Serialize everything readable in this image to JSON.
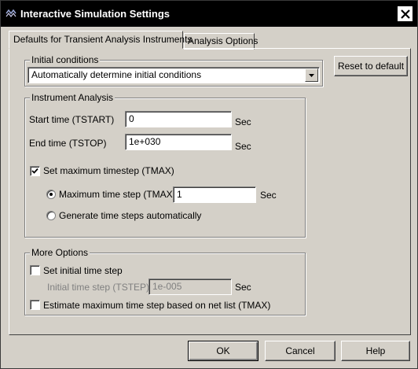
{
  "window": {
    "title": "Interactive Simulation Settings",
    "close_label": "close"
  },
  "tabs": [
    {
      "label": "Defaults for Transient Analysis Instruments",
      "active": true
    },
    {
      "label": "Analysis Options",
      "active": false
    }
  ],
  "reset_button": {
    "label": "Reset to default"
  },
  "initial_conditions": {
    "legend": "Initial conditions",
    "selected_value": "Automatically determine initial conditions"
  },
  "instrument_analysis": {
    "legend": "Instrument Analysis",
    "start_time": {
      "label": "Start time (TSTART)",
      "value": "0",
      "unit": "Sec"
    },
    "end_time": {
      "label": "End time (TSTOP)",
      "value": "1e+030",
      "unit": "Sec"
    },
    "set_max_timestep": {
      "label": "Set maximum timestep (TMAX)",
      "checked": true
    },
    "max_time_step": {
      "label": "Maximum time step (TMAX)",
      "value": "1",
      "unit": "Sec",
      "selected": true
    },
    "generate_auto": {
      "label": "Generate time steps automatically",
      "selected": false
    }
  },
  "more_options": {
    "legend": "More Options",
    "set_initial_time_step": {
      "label": "Set initial time step",
      "checked": false
    },
    "initial_time_step": {
      "label": "Initial time step (TSTEP)",
      "value": "1e-005",
      "unit": "Sec"
    },
    "estimate_max": {
      "label": "Estimate maximum time step based on net list (TMAX)",
      "checked": false
    }
  },
  "footer": {
    "ok_label": "OK",
    "cancel_label": "Cancel",
    "help_label": "Help"
  },
  "colors": {
    "face": "#d4d0c8",
    "titlebar": "#000000",
    "disabled_text": "#808080"
  }
}
